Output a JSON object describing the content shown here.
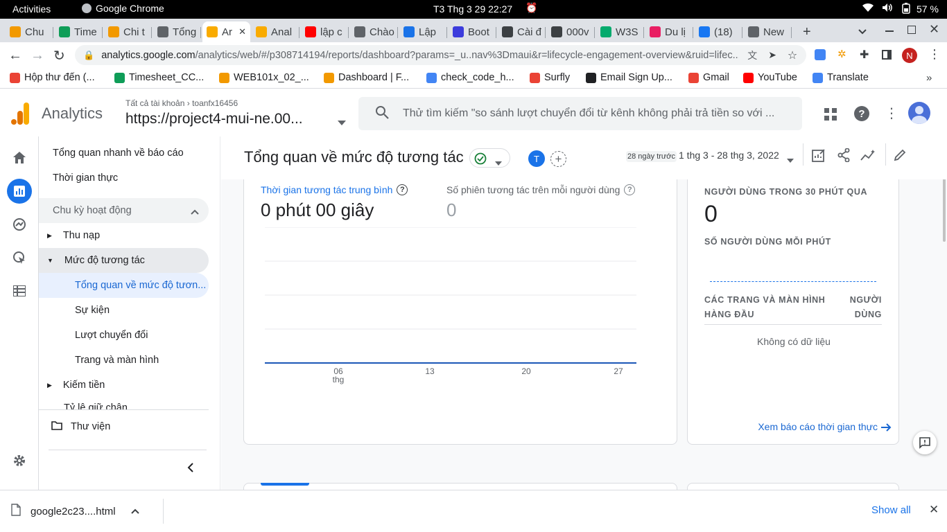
{
  "system": {
    "activities": "Activities",
    "app": "Google Chrome",
    "clock": "T3 Thg 3 29  22:27",
    "battery": "57 %"
  },
  "tabs": [
    {
      "label": "Chu",
      "color": "#f29900"
    },
    {
      "label": "Time",
      "color": "#0f9d58"
    },
    {
      "label": "Chi t",
      "color": "#f29900"
    },
    {
      "label": "Tổng",
      "color": "#5f6368"
    },
    {
      "label": "Ar",
      "color": "#f9ab00"
    },
    {
      "label": "Anal",
      "color": "#f9ab00"
    },
    {
      "label": "lập c",
      "color": "#ff0000"
    },
    {
      "label": "Chào",
      "color": "#5f6368"
    },
    {
      "label": "Lập",
      "color": "#1a73e8"
    },
    {
      "label": "Boot",
      "color": "#3c3cdc"
    },
    {
      "label": "Cài đ",
      "color": "#3c4043"
    },
    {
      "label": "000v",
      "color": "#3c4043"
    },
    {
      "label": "W3S",
      "color": "#04aa6d"
    },
    {
      "label": "Du lị",
      "color": "#e91e63"
    },
    {
      "label": "(18)",
      "color": "#1877f2"
    },
    {
      "label": "New",
      "color": "#5f6368"
    }
  ],
  "url": {
    "host": "analytics.google.com",
    "path": "/analytics/web/#/p308714194/reports/dashboard?params=_u..nav%3Dmaui&r=lifecycle-engagement-overview&ruid=lifec..."
  },
  "profile_initial": "N",
  "bookmarks": [
    {
      "label": "Hộp thư đến (...",
      "color": "#ea4335"
    },
    {
      "label": "Timesheet_CC...",
      "color": "#0f9d58"
    },
    {
      "label": "WEB101x_02_...",
      "color": "#f29900"
    },
    {
      "label": "Dashboard | F...",
      "color": "#f29900"
    },
    {
      "label": "check_code_h...",
      "color": "#4285f4"
    },
    {
      "label": "Surfly",
      "color": "#ea4335"
    },
    {
      "label": "Email Sign Up...",
      "color": "#202124"
    },
    {
      "label": "Gmail",
      "color": "#ea4335"
    },
    {
      "label": "YouTube",
      "color": "#ff0000"
    },
    {
      "label": "Translate",
      "color": "#4285f4"
    }
  ],
  "ga": {
    "product": "Analytics",
    "breadcrumb_all": "Tất cả tài khoản",
    "breadcrumb_account": "toanfx16456",
    "property": "https://project4-mui-ne.00...",
    "search_placeholder": "Thử tìm kiếm \"so sánh lượt chuyển đổi từ kênh không phải trả tiền so với ...",
    "avatar_initial": "T"
  },
  "nav": {
    "quick_overview": "Tổng quan nhanh về báo cáo",
    "realtime": "Thời gian thực",
    "lifecycle": "Chu kỳ hoạt động",
    "acquisition": "Thu nạp",
    "engagement": "Mức độ tương tác",
    "engagement_overview": "Tổng quan về mức độ tươn...",
    "events": "Sự kiện",
    "conversions": "Lượt chuyển đổi",
    "pages_screens": "Trang và màn hình",
    "monetization": "Kiếm tiền",
    "retention": "Tỷ lệ giữ chân",
    "library": "Thư viện"
  },
  "report": {
    "title": "Tổng quan về mức độ tương tác",
    "comparison_initial": "T",
    "date_hint": "28 ngày trước",
    "date_range": "1 thg 3 - 28 thg 3, 2022"
  },
  "metrics": {
    "avg_engagement_label": "Thời gian tương tác trung bình",
    "avg_engagement_value": "0 phút 00 giây",
    "sessions_per_user_label": "Số phiên tương tác trên mỗi người dùng",
    "sessions_per_user_value": "0"
  },
  "chart_data": {
    "type": "line",
    "x_ticks": [
      "06",
      "13",
      "20",
      "27"
    ],
    "x_tick_sublabel": "thg",
    "series": [
      {
        "values": [
          0,
          0,
          0,
          0,
          0
        ]
      }
    ],
    "ylim": [
      0,
      4
    ],
    "grid": true
  },
  "realtime_card": {
    "users_30min_label": "NGƯỜI DÙNG TRONG 30 PHÚT QUA",
    "users_30min_value": "0",
    "users_per_min_label": "SỐ NGƯỜI DÙNG MỖI PHÚT",
    "top_pages_col1_line1": "CÁC TRANG VÀ MÀN HÌNH",
    "top_pages_col1_line2": "HÀNG ĐẦU",
    "top_pages_col2_line1": "NGƯỜI",
    "top_pages_col2_line2": "DÙNG",
    "no_data": "Không có dữ liệu",
    "link": "Xem báo cáo thời gian thực"
  },
  "download": {
    "file": "google2c23....html",
    "show_all": "Show all"
  }
}
